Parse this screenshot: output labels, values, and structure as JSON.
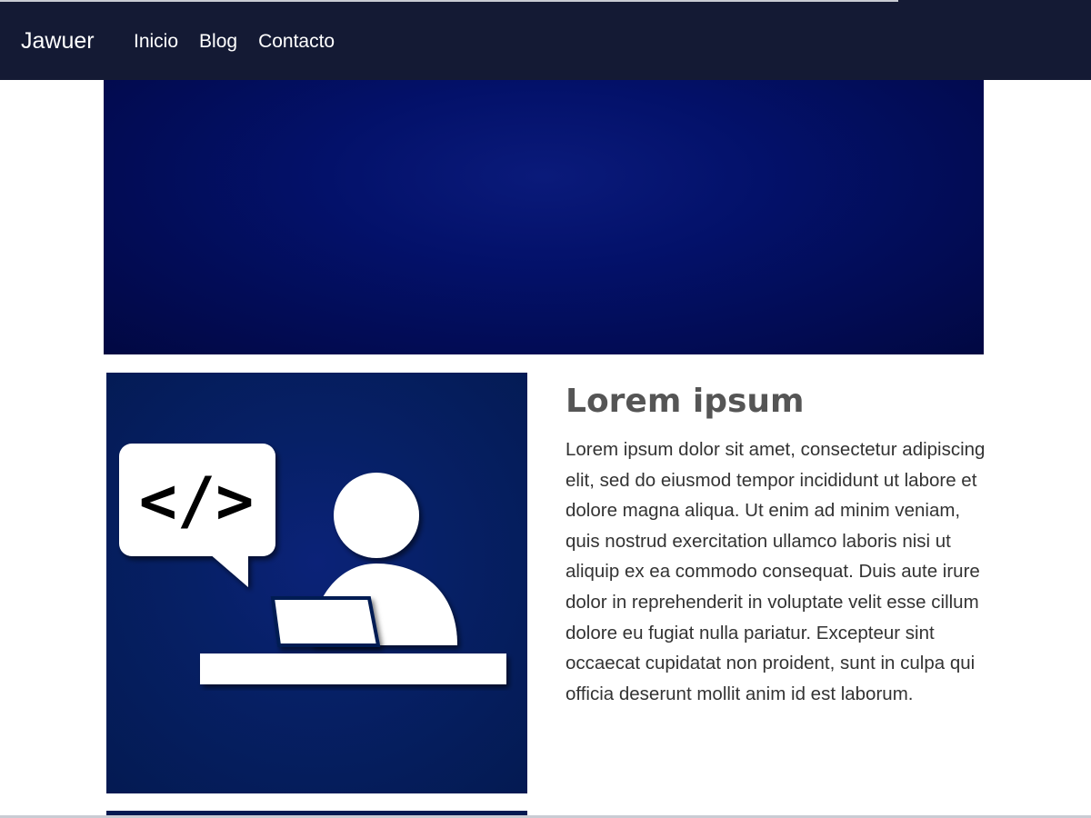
{
  "navbar": {
    "brand": "Jawuer",
    "links": [
      {
        "label": "Inicio"
      },
      {
        "label": "Blog"
      },
      {
        "label": "Contacto"
      }
    ]
  },
  "hero": {
    "colors": {
      "center": "#0a1a7a",
      "edge": "#010842"
    }
  },
  "feature": {
    "image_icon": "developer-at-laptop-icon",
    "code_symbol": "</>",
    "title": "Lorem ipsum",
    "body": "Lorem ipsum dolor sit amet, consectetur adipiscing elit, sed do eiusmod tempor incididunt ut labore et dolore magna aliqua. Ut enim ad minim veniam, quis nostrud exercitation ullamco laboris nisi ut aliquip ex ea commodo consequat. Duis aute irure dolor in reprehenderit in voluptate velit esse cillum dolore eu fugiat nulla pariatur. Excepteur sint occaecat cupidatat non proident, sunt in culpa qui officia deserunt mollit anim id est laborum."
  },
  "colors": {
    "navbar_bg": "#141a34",
    "title_text": "#555555",
    "body_text": "#333333"
  }
}
